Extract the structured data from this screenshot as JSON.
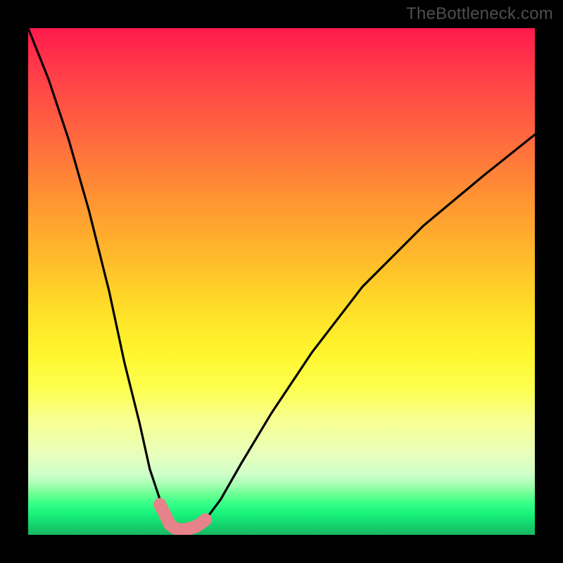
{
  "watermark": "TheBottleneck.com",
  "chart_data": {
    "type": "line",
    "title": "",
    "xlabel": "",
    "ylabel": "",
    "xlim": [
      0,
      100
    ],
    "ylim": [
      0,
      100
    ],
    "series": [
      {
        "name": "bottleneck-curve",
        "x": [
          0,
          4,
          8,
          12,
          16,
          19,
          22,
          24,
          26,
          27,
          28,
          29,
          30,
          31,
          32,
          33,
          35,
          38,
          42,
          48,
          56,
          66,
          78,
          90,
          100
        ],
        "values": [
          100,
          90,
          78,
          64,
          48,
          34,
          22,
          13,
          7,
          4,
          2,
          1.3,
          1,
          1,
          1.2,
          1.6,
          3,
          7,
          14,
          24,
          36,
          49,
          61,
          71,
          79
        ]
      }
    ],
    "highlight": {
      "name": "optimal-range",
      "x": [
        26,
        27,
        28,
        29,
        30,
        31,
        32,
        33,
        34,
        35
      ],
      "values": [
        6,
        4,
        2,
        1.3,
        1,
        1.1,
        1.3,
        1.6,
        2.2,
        3
      ]
    },
    "gradient_stops": [
      {
        "pct": 0,
        "color": "#ff1a4d"
      },
      {
        "pct": 50,
        "color": "#ffe028"
      },
      {
        "pct": 90,
        "color": "#6bff94"
      },
      {
        "pct": 100,
        "color": "#16b862"
      }
    ]
  }
}
